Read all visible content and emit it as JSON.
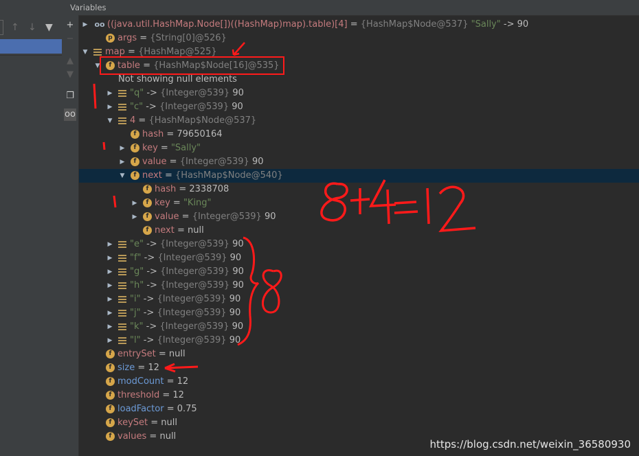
{
  "panel_title": "Variables",
  "gutter_buttons": [
    {
      "icon": "+",
      "name": "add-watch-button"
    },
    {
      "icon": "−",
      "name": "remove-watch-button"
    },
    {
      "icon": "▲",
      "name": "move-up-button"
    },
    {
      "icon": "▼",
      "name": "move-down-button"
    },
    {
      "icon": "❐",
      "name": "copy-button"
    },
    {
      "icon": "oo",
      "name": "show-watches-button"
    }
  ],
  "rows": [
    {
      "depth": 0,
      "arrow": "▶",
      "icon": "oo",
      "name": "((java.util.HashMap.Node[])((HashMap)map).table)[4]",
      "eq": " = ",
      "type": "{HashMap$Node@537}",
      "val": " \"Sally\" -> 90",
      "nameStyle": "n",
      "valStyle": "s-mixed"
    },
    {
      "depth": 1,
      "arrow": "",
      "icon": "p",
      "name": "args",
      "eq": " = ",
      "type": "{String[0]@526}",
      "val": ""
    },
    {
      "depth": 0,
      "arrow": "▼",
      "icon": "list",
      "name": "map",
      "eq": " = ",
      "type": "{HashMap@525}",
      "val": ""
    },
    {
      "depth": 1,
      "arrow": "▼",
      "icon": "f",
      "name": "table",
      "eq": " = ",
      "type": "{HashMap$Node[16]@535}",
      "val": ""
    },
    {
      "depth": 2,
      "arrow": "",
      "icon": "",
      "name": "Not showing null elements",
      "eq": "",
      "type": "",
      "val": "",
      "nameStyle": "plain"
    },
    {
      "depth": 2,
      "arrow": "▶",
      "icon": "list",
      "name": "\"q\"",
      "eq": " -> ",
      "type": "{Integer@539}",
      "val": " 90",
      "nameStyle": "str"
    },
    {
      "depth": 2,
      "arrow": "▶",
      "icon": "list",
      "name": "\"c\"",
      "eq": " -> ",
      "type": "{Integer@539}",
      "val": " 90",
      "nameStyle": "str"
    },
    {
      "depth": 2,
      "arrow": "▼",
      "icon": "list",
      "name": "4",
      "eq": " = ",
      "type": "{HashMap$Node@537}",
      "val": ""
    },
    {
      "depth": 3,
      "arrow": "",
      "icon": "f",
      "name": "hash",
      "eq": " = ",
      "type": "",
      "val": "79650164"
    },
    {
      "depth": 3,
      "arrow": "▶",
      "icon": "f",
      "name": "key",
      "eq": " = ",
      "type": "",
      "val": "\"Sally\"",
      "valStyle": "str"
    },
    {
      "depth": 3,
      "arrow": "▶",
      "icon": "f",
      "name": "value",
      "eq": " = ",
      "type": "{Integer@539}",
      "val": " 90"
    },
    {
      "depth": 3,
      "arrow": "▼",
      "icon": "f",
      "name": "next",
      "eq": " = ",
      "type": "{HashMap$Node@540}",
      "val": "",
      "selected": true
    },
    {
      "depth": 4,
      "arrow": "",
      "icon": "f",
      "name": "hash",
      "eq": " = ",
      "type": "",
      "val": "2338708"
    },
    {
      "depth": 4,
      "arrow": "▶",
      "icon": "f",
      "name": "key",
      "eq": " = ",
      "type": "",
      "val": "\"King\"",
      "valStyle": "str"
    },
    {
      "depth": 4,
      "arrow": "▶",
      "icon": "f",
      "name": "value",
      "eq": " = ",
      "type": "{Integer@539}",
      "val": " 90"
    },
    {
      "depth": 4,
      "arrow": "",
      "icon": "f",
      "name": "next",
      "eq": " = ",
      "type": "",
      "val": "null"
    },
    {
      "depth": 2,
      "arrow": "▶",
      "icon": "list",
      "name": "\"e\"",
      "eq": " -> ",
      "type": "{Integer@539}",
      "val": " 90",
      "nameStyle": "str"
    },
    {
      "depth": 2,
      "arrow": "▶",
      "icon": "list",
      "name": "\"f\"",
      "eq": " -> ",
      "type": "{Integer@539}",
      "val": " 90",
      "nameStyle": "str"
    },
    {
      "depth": 2,
      "arrow": "▶",
      "icon": "list",
      "name": "\"g\"",
      "eq": " -> ",
      "type": "{Integer@539}",
      "val": " 90",
      "nameStyle": "str"
    },
    {
      "depth": 2,
      "arrow": "▶",
      "icon": "list",
      "name": "\"h\"",
      "eq": " -> ",
      "type": "{Integer@539}",
      "val": " 90",
      "nameStyle": "str"
    },
    {
      "depth": 2,
      "arrow": "▶",
      "icon": "list",
      "name": "\"i\"",
      "eq": " -> ",
      "type": "{Integer@539}",
      "val": " 90",
      "nameStyle": "str"
    },
    {
      "depth": 2,
      "arrow": "▶",
      "icon": "list",
      "name": "\"j\"",
      "eq": " -> ",
      "type": "{Integer@539}",
      "val": " 90",
      "nameStyle": "str"
    },
    {
      "depth": 2,
      "arrow": "▶",
      "icon": "list",
      "name": "\"k\"",
      "eq": " -> ",
      "type": "{Integer@539}",
      "val": " 90",
      "nameStyle": "str"
    },
    {
      "depth": 2,
      "arrow": "▶",
      "icon": "list",
      "name": "\"l\"",
      "eq": " -> ",
      "type": "{Integer@539}",
      "val": " 90",
      "nameStyle": "str"
    },
    {
      "depth": 1,
      "arrow": "",
      "icon": "f",
      "name": "entrySet",
      "eq": " = ",
      "type": "",
      "val": "null"
    },
    {
      "depth": 1,
      "arrow": "",
      "icon": "f",
      "name": "size",
      "eq": " = ",
      "type": "",
      "val": "12",
      "nameStyle": "blue"
    },
    {
      "depth": 1,
      "arrow": "",
      "icon": "f",
      "name": "modCount",
      "eq": " = ",
      "type": "",
      "val": "12",
      "nameStyle": "blue"
    },
    {
      "depth": 1,
      "arrow": "",
      "icon": "f",
      "name": "threshold",
      "eq": " = ",
      "type": "",
      "val": "12"
    },
    {
      "depth": 1,
      "arrow": "",
      "icon": "f",
      "name": "loadFactor",
      "eq": " = ",
      "type": "",
      "val": "0.75",
      "nameStyle": "blue"
    },
    {
      "depth": 1,
      "arrow": "",
      "icon": "f",
      "name": "keySet",
      "eq": " = ",
      "type": "",
      "val": "null"
    },
    {
      "depth": 1,
      "arrow": "",
      "icon": "f",
      "name": "values",
      "eq": " = ",
      "type": "",
      "val": "null"
    }
  ],
  "annotations": {
    "sum_text": "8+4=12",
    "brace_label": "8",
    "marks": [
      "1",
      "1",
      "1"
    ]
  },
  "watermark": "https://blog.csdn.net/weixin_36580930"
}
